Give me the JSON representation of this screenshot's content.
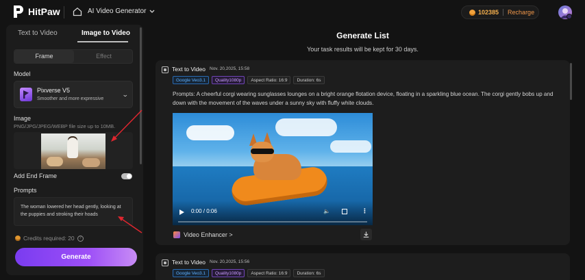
{
  "header": {
    "logo_text": "HitPaw",
    "app_title": "AI Video Generator",
    "credits": "102385",
    "recharge_label": "Recharge"
  },
  "left_panel": {
    "tabs": [
      "Text to Video",
      "Image to Video"
    ],
    "active_tab": "Image to Video",
    "modes": [
      "Frame",
      "Effect"
    ],
    "active_mode": "Frame",
    "model_label": "Model",
    "model_name": "Pixverse V5",
    "model_desc": "Smoother and more expressive",
    "image_label": "Image",
    "image_hint": "PNG/JPG/JPEG/WEBP file size up to 10MB.",
    "end_frame_label": "Add End Frame",
    "end_frame_enabled": false,
    "prompts_label": "Prompts",
    "prompt_text": "The woman lowered her head gently, looking at the puppies and stroking their hoads",
    "credits_required": "Credits required: 20",
    "generate_label": "Generate"
  },
  "main": {
    "title": "Generate List",
    "subtitle": "Your task results will be kept for 30 days.",
    "tasks": [
      {
        "type": "Text to Video",
        "time": "Nov. 20,2025, 15:58",
        "tags": [
          "Google Veo3.1",
          "Quality1080p",
          "Aspect Ratio: 16:9",
          "Duration: 6s"
        ],
        "prompt": "Prompts: A cheerful corgi wearing sunglasses lounges on a bright orange flotation device, floating in a sparkling blue ocean. The corgi gently bobs up and down with the movement of the waves under a sunny sky with fluffy white clouds.",
        "video_time": "0:00 / 0:06",
        "enhancer_label": "Video Enhancer >"
      },
      {
        "type": "Text to Video",
        "time": "Nov. 20,2025, 15:56",
        "tags": [
          "Google Veo3.1",
          "Quality1080p",
          "Aspect Ratio: 16:9",
          "Duration: 6s"
        ]
      }
    ]
  },
  "colors": {
    "accent_purple": "#9d4ff7",
    "credit_orange": "#f6b04d",
    "annotation_red": "#e0262f"
  }
}
